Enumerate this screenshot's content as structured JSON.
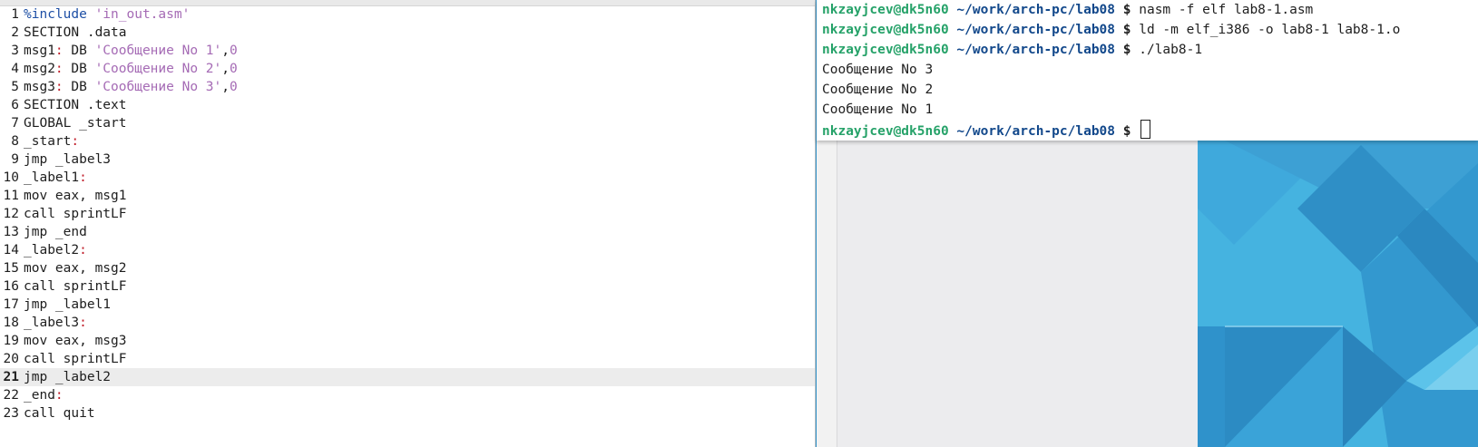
{
  "editor": {
    "current_line": 21,
    "lines": [
      {
        "n": "1",
        "tokens": [
          {
            "t": "%include ",
            "c": "t-dir"
          },
          {
            "t": "'in_out.asm'",
            "c": "t-str"
          }
        ]
      },
      {
        "n": "2",
        "tokens": [
          {
            "t": "SECTION .data"
          }
        ]
      },
      {
        "n": "3",
        "tokens": [
          {
            "t": "msg1"
          },
          {
            "t": ":",
            "c": "t-col"
          },
          {
            "t": " DB "
          },
          {
            "t": "'Сообщение No 1'",
            "c": "t-str"
          },
          {
            "t": ","
          },
          {
            "t": "0",
            "c": "t-num"
          }
        ]
      },
      {
        "n": "4",
        "tokens": [
          {
            "t": "msg2"
          },
          {
            "t": ":",
            "c": "t-col"
          },
          {
            "t": " DB "
          },
          {
            "t": "'Сообщение No 2'",
            "c": "t-str"
          },
          {
            "t": ","
          },
          {
            "t": "0",
            "c": "t-num"
          }
        ]
      },
      {
        "n": "5",
        "tokens": [
          {
            "t": "msg3"
          },
          {
            "t": ":",
            "c": "t-col"
          },
          {
            "t": " DB "
          },
          {
            "t": "'Сообщение No 3'",
            "c": "t-str"
          },
          {
            "t": ","
          },
          {
            "t": "0",
            "c": "t-num"
          }
        ]
      },
      {
        "n": "6",
        "tokens": [
          {
            "t": "SECTION .text"
          }
        ]
      },
      {
        "n": "7",
        "tokens": [
          {
            "t": "GLOBAL _start"
          }
        ]
      },
      {
        "n": "8",
        "tokens": [
          {
            "t": "_start"
          },
          {
            "t": ":",
            "c": "t-col"
          }
        ]
      },
      {
        "n": "9",
        "tokens": [
          {
            "t": "jmp _label3"
          }
        ]
      },
      {
        "n": "10",
        "tokens": [
          {
            "t": "_label1"
          },
          {
            "t": ":",
            "c": "t-col"
          }
        ]
      },
      {
        "n": "11",
        "tokens": [
          {
            "t": "mov eax, msg1"
          }
        ]
      },
      {
        "n": "12",
        "tokens": [
          {
            "t": "call sprintLF"
          }
        ]
      },
      {
        "n": "13",
        "tokens": [
          {
            "t": "jmp _end"
          }
        ]
      },
      {
        "n": "14",
        "tokens": [
          {
            "t": "_label2"
          },
          {
            "t": ":",
            "c": "t-col"
          }
        ]
      },
      {
        "n": "15",
        "tokens": [
          {
            "t": "mov eax, msg2"
          }
        ]
      },
      {
        "n": "16",
        "tokens": [
          {
            "t": "call sprintLF"
          }
        ]
      },
      {
        "n": "17",
        "tokens": [
          {
            "t": "jmp _label1"
          }
        ]
      },
      {
        "n": "18",
        "tokens": [
          {
            "t": "_label3"
          },
          {
            "t": ":",
            "c": "t-col"
          }
        ]
      },
      {
        "n": "19",
        "tokens": [
          {
            "t": "mov eax, msg3"
          }
        ]
      },
      {
        "n": "20",
        "tokens": [
          {
            "t": "call sprintLF"
          }
        ]
      },
      {
        "n": "21",
        "tokens": [
          {
            "t": "jmp _label2"
          }
        ]
      },
      {
        "n": "22",
        "tokens": [
          {
            "t": "_end"
          },
          {
            "t": ":",
            "c": "t-col"
          }
        ]
      },
      {
        "n": "23",
        "tokens": [
          {
            "t": "call quit"
          }
        ]
      }
    ]
  },
  "terminal": {
    "lines": [
      {
        "type": "prompt",
        "user": "nkzayjcev@dk5n60",
        "path": "~/work/arch-pc/lab08",
        "symbol": "$",
        "command": "nasm -f elf lab8-1.asm"
      },
      {
        "type": "prompt",
        "user": "nkzayjcev@dk5n60",
        "path": "~/work/arch-pc/lab08",
        "symbol": "$",
        "command": "ld -m elf_i386 -o lab8-1 lab8-1.o"
      },
      {
        "type": "prompt",
        "user": "nkzayjcev@dk5n60",
        "path": "~/work/arch-pc/lab08",
        "symbol": "$",
        "command": "./lab8-1"
      },
      {
        "type": "output",
        "text": "Сообщение No 3"
      },
      {
        "type": "output",
        "text": "Сообщение No 2"
      },
      {
        "type": "output",
        "text": "Сообщение No 1"
      },
      {
        "type": "prompt",
        "user": "nkzayjcev@dk5n60",
        "path": "~/work/arch-pc/lab08",
        "symbol": "$",
        "command": "",
        "cursor": true
      }
    ]
  },
  "colors": {
    "user": "#26a269",
    "path": "#12488b",
    "string": "#a56bb5",
    "colon": "#c01c28",
    "directive": "#1e4fa5",
    "wallpaper": "#3aa6d8"
  }
}
